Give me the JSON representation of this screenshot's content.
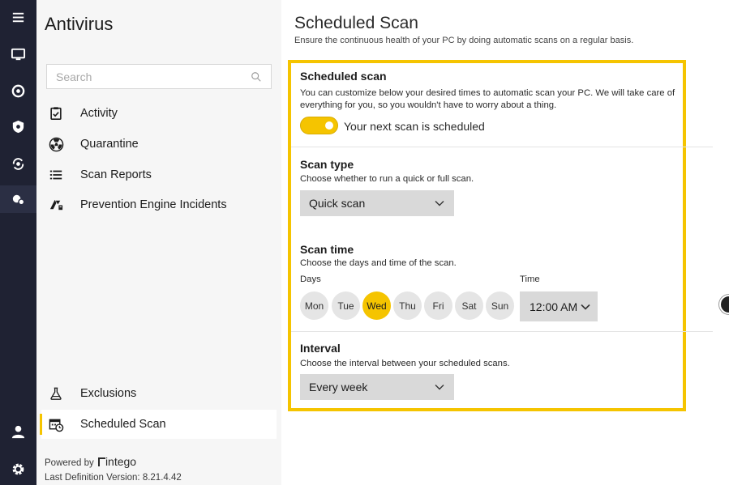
{
  "rail": {
    "items": [
      "menu-icon",
      "monitor-icon",
      "scan-ring-icon",
      "shield-icon",
      "refresh-shield-icon",
      "antivirus-icon",
      "user-icon",
      "gear-icon"
    ]
  },
  "sidebar": {
    "title": "Antivirus",
    "search_placeholder": "Search",
    "items": [
      {
        "label": "Activity",
        "icon": "clipboard-check-icon"
      },
      {
        "label": "Quarantine",
        "icon": "radiation-icon"
      },
      {
        "label": "Scan Reports",
        "icon": "list-icon"
      },
      {
        "label": "Prevention Engine Incidents",
        "icon": "incident-icon"
      },
      {
        "label": "Exclusions",
        "icon": "flask-icon"
      },
      {
        "label": "Scheduled Scan",
        "icon": "calendar-clock-icon"
      }
    ],
    "footer": {
      "powered_by": "Powered by",
      "brand": "intego",
      "definition_version": "Last Definition Version:  8.21.4.42"
    }
  },
  "main": {
    "title": "Scheduled Scan",
    "subtitle": "Ensure the continuous health of your PC by doing automatic scans on a regular basis.",
    "scheduled": {
      "heading": "Scheduled scan",
      "description": "You can customize below your desired times to automatic scan your PC. We will take care of everything for you, so you wouldn't have to worry about a thing.",
      "toggle_on": true,
      "toggle_label": "Your next scan is scheduled"
    },
    "scan_type": {
      "heading": "Scan type",
      "description": "Choose whether to run a quick or full scan.",
      "value": "Quick scan"
    },
    "scan_time": {
      "heading": "Scan time",
      "description": "Choose the days and time of the scan.",
      "days_label": "Days",
      "time_label": "Time",
      "days": [
        "Mon",
        "Tue",
        "Wed",
        "Thu",
        "Fri",
        "Sat",
        "Sun"
      ],
      "selected_day": "Wed",
      "time_value": "12:00 AM"
    },
    "interval": {
      "heading": "Interval",
      "description": "Choose the interval between your scheduled scans.",
      "value": "Every week"
    }
  },
  "colors": {
    "accent": "#f5c400",
    "rail_bg": "#1f2233",
    "sidebar_bg": "#f6f6f6"
  }
}
